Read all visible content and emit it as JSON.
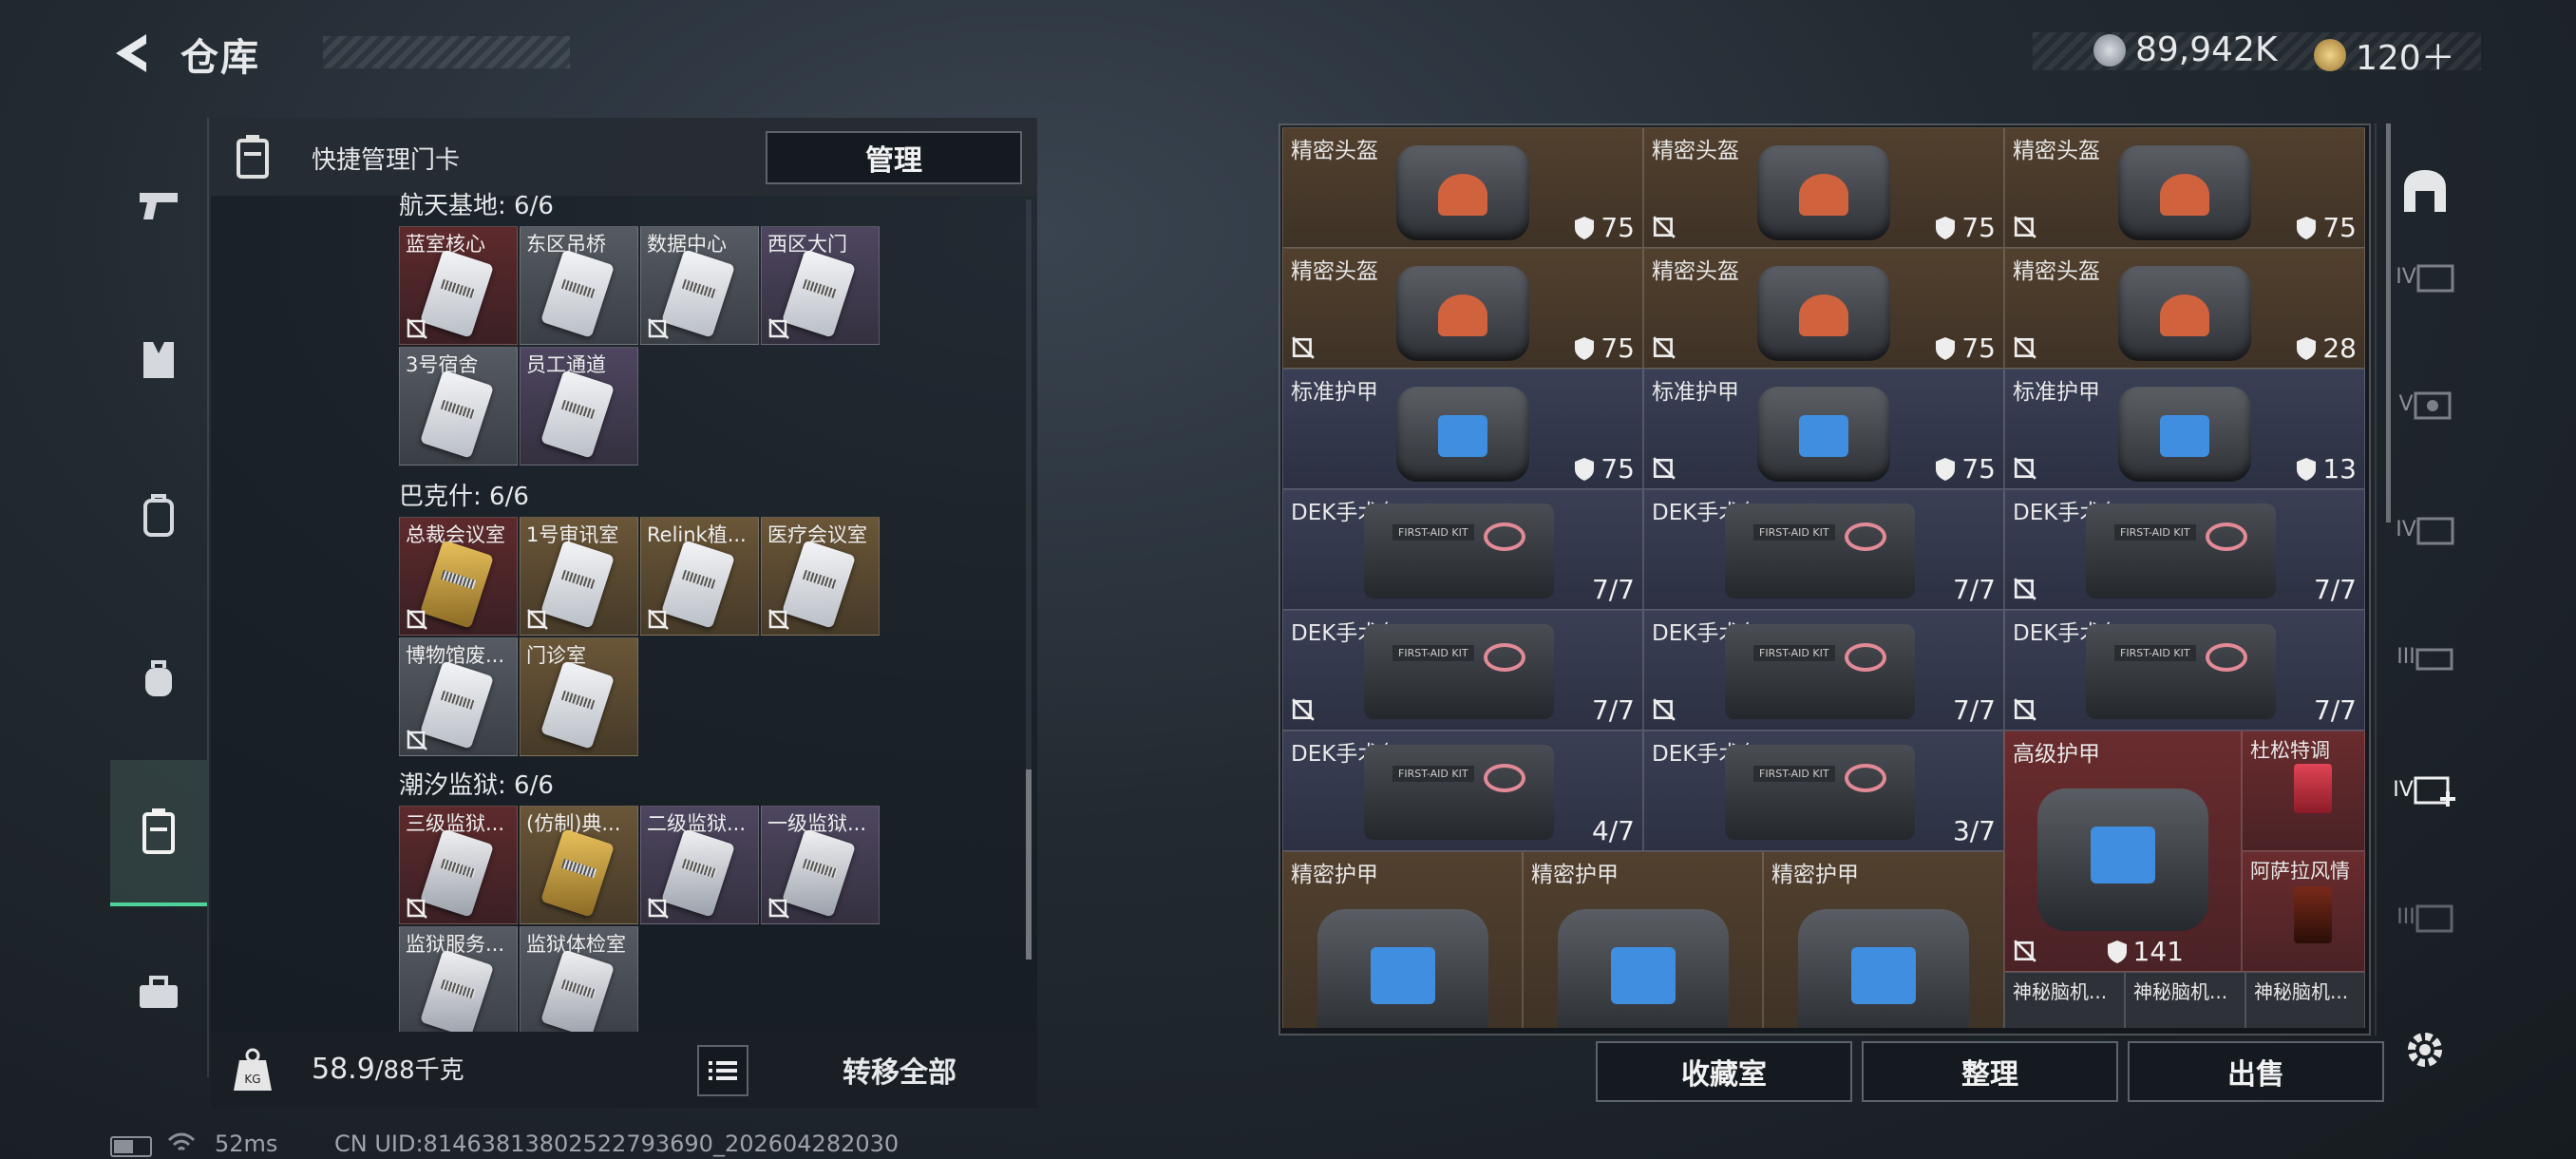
{
  "header": {
    "title": "仓库",
    "coins_value": "89,942K",
    "tokens_value": "120＋"
  },
  "left_nav": {
    "items": [
      {
        "name": "weapons",
        "icon": "pistol-icon"
      },
      {
        "name": "armor",
        "icon": "vest-icon"
      },
      {
        "name": "backpack",
        "icon": "backpack-icon"
      },
      {
        "name": "bag",
        "icon": "pouch-icon"
      },
      {
        "name": "keycards",
        "icon": "keycard-holder-icon"
      },
      {
        "name": "toolbox",
        "icon": "toolbox-icon"
      }
    ]
  },
  "card_panel": {
    "header_label": "快捷管理门卡",
    "manage_label": "管理",
    "sections": [
      {
        "title": "航天基地: 6/6",
        "cards": [
          {
            "label": "蓝室核心",
            "tier": "red"
          },
          {
            "label": "东区吊桥",
            "tier": "gray"
          },
          {
            "label": "数据中心",
            "tier": "gray"
          },
          {
            "label": "西区大门",
            "tier": "purple"
          },
          {
            "label": "3号宿舍",
            "tier": "gray"
          },
          {
            "label": "员工通道",
            "tier": "purple"
          }
        ]
      },
      {
        "title": "巴克什: 6/6",
        "cards": [
          {
            "label": "总裁会议室",
            "tier": "red"
          },
          {
            "label": "1号审讯室",
            "tier": "gold"
          },
          {
            "label": "Relink植...",
            "tier": "gold"
          },
          {
            "label": "医疗会议室",
            "tier": "gold"
          },
          {
            "label": "博物馆废...",
            "tier": "gray"
          },
          {
            "label": "门诊室",
            "tier": "gold"
          }
        ]
      },
      {
        "title": "潮汐监狱: 6/6",
        "cards": [
          {
            "label": "三级监狱...",
            "tier": "red"
          },
          {
            "label": "(仿制)典...",
            "tier": "gold"
          },
          {
            "label": "二级监狱...",
            "tier": "purple"
          },
          {
            "label": "一级监狱...",
            "tier": "purple"
          },
          {
            "label": "监狱服务...",
            "tier": "gray"
          },
          {
            "label": "监狱体检室",
            "tier": "gray"
          }
        ]
      }
    ],
    "capacity_value": "58.9",
    "capacity_total": "/88千克",
    "transfer_all_label": "转移全部"
  },
  "inventory": {
    "rows": [
      [
        {
          "name": "精密头盔",
          "value": "75",
          "kind": "helmet",
          "tier": "brown"
        },
        {
          "name": "精密头盔",
          "value": "75",
          "kind": "helmet",
          "tier": "brown"
        },
        {
          "name": "精密头盔",
          "value": "75",
          "kind": "helmet",
          "tier": "brown"
        }
      ],
      [
        {
          "name": "精密头盔",
          "value": "75",
          "kind": "helmet",
          "tier": "brown"
        },
        {
          "name": "精密头盔",
          "value": "75",
          "kind": "helmet",
          "tier": "brown"
        },
        {
          "name": "精密头盔",
          "value": "28",
          "kind": "helmet",
          "tier": "brown"
        }
      ],
      [
        {
          "name": "标准护甲",
          "value": "75",
          "kind": "helmet-blue",
          "tier": "blue"
        },
        {
          "name": "标准护甲",
          "value": "75",
          "kind": "helmet-blue",
          "tier": "blue"
        },
        {
          "name": "标准护甲",
          "value": "13",
          "kind": "helmet-blue",
          "tier": "blue"
        }
      ],
      [
        {
          "name": "DEK手术包",
          "value": "7/7",
          "kind": "medkit",
          "tier": "blue"
        },
        {
          "name": "DEK手术包",
          "value": "7/7",
          "kind": "medkit",
          "tier": "blue"
        },
        {
          "name": "DEK手术包",
          "value": "7/7",
          "kind": "medkit",
          "tier": "blue"
        }
      ],
      [
        {
          "name": "DEK手术包",
          "value": "7/7",
          "kind": "medkit",
          "tier": "blue"
        },
        {
          "name": "DEK手术包",
          "value": "7/7",
          "kind": "medkit",
          "tier": "blue"
        },
        {
          "name": "DEK手术包",
          "value": "7/7",
          "kind": "medkit",
          "tier": "blue"
        }
      ],
      [
        {
          "name": "DEK手术包",
          "value": "4/7",
          "kind": "medkit",
          "tier": "blue"
        },
        {
          "name": "DEK手术包",
          "value": "3/7",
          "kind": "medkit",
          "tier": "blue"
        }
      ]
    ],
    "big_armor": {
      "name": "高级护甲",
      "value": "141"
    },
    "drinks": [
      {
        "name": "杜松特调"
      },
      {
        "name": "阿萨拉风情"
      }
    ],
    "precision_armor": [
      "精密护甲",
      "精密护甲",
      "精密护甲"
    ],
    "brain_items": [
      "神秘脑机...",
      "神秘脑机...",
      "神秘脑机..."
    ],
    "actions": {
      "collection": "收藏室",
      "sort": "整理",
      "sell": "出售"
    }
  },
  "right_nav": {
    "tiers": [
      "IV",
      "V",
      "IV",
      "III",
      "IV",
      "III"
    ]
  },
  "status_bar": {
    "ping": "52ms",
    "uid": "CN UID:8146381380252279369​0_202604282030"
  },
  "colors": {
    "accent_green": "#4ed49a"
  }
}
